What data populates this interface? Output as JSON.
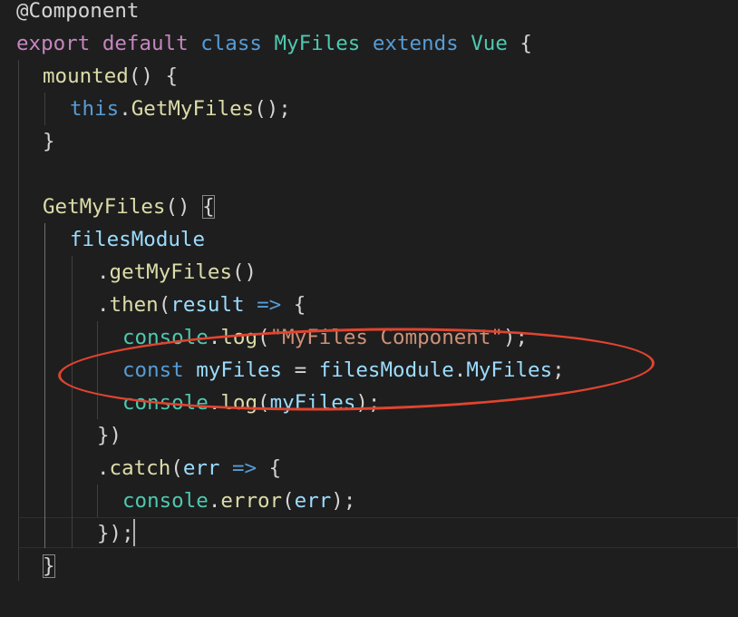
{
  "colors": {
    "background": "#1e1e1e",
    "keyword": "#c586c0",
    "storage": "#569cd6",
    "class_name": "#4ec9b0",
    "function": "#dcdcaa",
    "variable": "#9cdcfe",
    "string": "#ce9178",
    "punctuation": "#d4d4d4",
    "annotation_ellipse": "#e0442f"
  },
  "code": {
    "lines": [
      {
        "tokens": [
          {
            "t": "@Component",
            "c": "punctuation"
          }
        ]
      },
      {
        "tokens": [
          {
            "t": "export",
            "c": "keyword"
          },
          {
            "t": " "
          },
          {
            "t": "default",
            "c": "keyword"
          },
          {
            "t": " "
          },
          {
            "t": "class",
            "c": "storage"
          },
          {
            "t": " "
          },
          {
            "t": "MyFiles",
            "c": "class_name"
          },
          {
            "t": " "
          },
          {
            "t": "extends",
            "c": "storage"
          },
          {
            "t": " "
          },
          {
            "t": "Vue",
            "c": "class_name"
          },
          {
            "t": " "
          },
          {
            "t": "{",
            "c": "punctuation"
          }
        ]
      },
      {
        "tokens": [
          {
            "t": "mounted",
            "c": "function"
          },
          {
            "t": "() {",
            "c": "punctuation"
          }
        ]
      },
      {
        "tokens": [
          {
            "t": "this",
            "c": "storage"
          },
          {
            "t": ".",
            "c": "punctuation"
          },
          {
            "t": "GetMyFiles",
            "c": "function"
          },
          {
            "t": "();",
            "c": "punctuation"
          }
        ]
      },
      {
        "tokens": [
          {
            "t": "}",
            "c": "punctuation"
          }
        ]
      },
      {
        "tokens": []
      },
      {
        "tokens": [
          {
            "t": "GetMyFiles",
            "c": "function"
          },
          {
            "t": "() ",
            "c": "punctuation"
          },
          {
            "t": "{",
            "c": "punctuation",
            "box": true
          }
        ]
      },
      {
        "tokens": [
          {
            "t": "filesModule",
            "c": "variable"
          }
        ]
      },
      {
        "tokens": [
          {
            "t": ".",
            "c": "punctuation"
          },
          {
            "t": "getMyFiles",
            "c": "function"
          },
          {
            "t": "()",
            "c": "punctuation"
          }
        ]
      },
      {
        "tokens": [
          {
            "t": ".",
            "c": "punctuation"
          },
          {
            "t": "then",
            "c": "function"
          },
          {
            "t": "(",
            "c": "punctuation"
          },
          {
            "t": "result",
            "c": "variable"
          },
          {
            "t": " "
          },
          {
            "t": "=>",
            "c": "storage"
          },
          {
            "t": " {",
            "c": "punctuation"
          }
        ]
      },
      {
        "tokens": [
          {
            "t": "console",
            "c": "class_name"
          },
          {
            "t": ".",
            "c": "punctuation"
          },
          {
            "t": "log",
            "c": "function"
          },
          {
            "t": "(",
            "c": "punctuation"
          },
          {
            "t": "\"MyFiles Component\"",
            "c": "string"
          },
          {
            "t": ");",
            "c": "punctuation"
          }
        ]
      },
      {
        "tokens": [
          {
            "t": "const",
            "c": "storage"
          },
          {
            "t": " "
          },
          {
            "t": "myFiles",
            "c": "variable"
          },
          {
            "t": " = ",
            "c": "punctuation"
          },
          {
            "t": "filesModule",
            "c": "variable"
          },
          {
            "t": ".",
            "c": "punctuation"
          },
          {
            "t": "MyFiles",
            "c": "variable"
          },
          {
            "t": ";",
            "c": "punctuation"
          }
        ]
      },
      {
        "tokens": [
          {
            "t": "console",
            "c": "class_name"
          },
          {
            "t": ".",
            "c": "punctuation"
          },
          {
            "t": "log",
            "c": "function"
          },
          {
            "t": "(",
            "c": "punctuation"
          },
          {
            "t": "myFiles",
            "c": "variable"
          },
          {
            "t": ");",
            "c": "punctuation"
          }
        ]
      },
      {
        "tokens": [
          {
            "t": "})",
            "c": "punctuation"
          }
        ]
      },
      {
        "tokens": [
          {
            "t": ".",
            "c": "punctuation"
          },
          {
            "t": "catch",
            "c": "function"
          },
          {
            "t": "(",
            "c": "punctuation"
          },
          {
            "t": "err",
            "c": "variable"
          },
          {
            "t": " "
          },
          {
            "t": "=>",
            "c": "storage"
          },
          {
            "t": " {",
            "c": "punctuation"
          }
        ]
      },
      {
        "tokens": [
          {
            "t": "console",
            "c": "class_name"
          },
          {
            "t": ".",
            "c": "punctuation"
          },
          {
            "t": "error",
            "c": "function"
          },
          {
            "t": "(",
            "c": "punctuation"
          },
          {
            "t": "err",
            "c": "variable"
          },
          {
            "t": ");",
            "c": "punctuation"
          }
        ]
      },
      {
        "tokens": [
          {
            "t": "});",
            "c": "punctuation"
          }
        ]
      },
      {
        "tokens": [
          {
            "t": "}",
            "c": "punctuation",
            "box": true
          }
        ]
      }
    ]
  }
}
